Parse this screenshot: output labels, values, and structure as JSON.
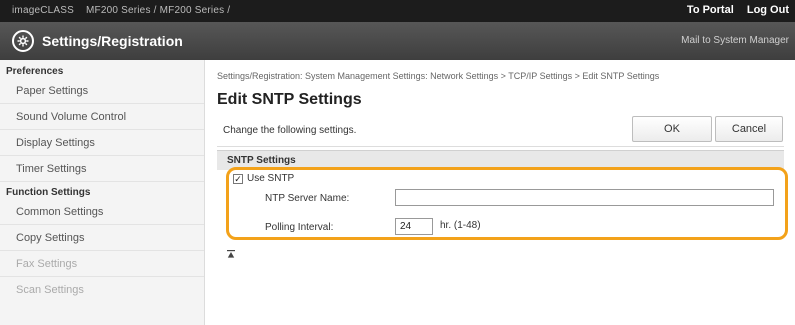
{
  "topbar": {
    "crumb": [
      "imageCLASS",
      "MF200 Series",
      "MF200 Series",
      ""
    ],
    "portal_label": "To Portal",
    "logout_label": "Log Out"
  },
  "header": {
    "title": "Settings/Registration",
    "mailto": "Mail to System Manager"
  },
  "sidebar": {
    "section_preferences": "Preferences",
    "preferences_items": [
      "Paper Settings",
      "Sound Volume Control",
      "Display Settings",
      "Timer Settings"
    ],
    "section_function": "Function Settings",
    "function_items": [
      "Common Settings",
      "Copy Settings",
      "Fax Settings",
      "Scan Settings"
    ]
  },
  "main": {
    "breadcrumb": "Settings/Registration: System Management Settings: Network Settings > TCP/IP Settings > Edit SNTP Settings",
    "title": "Edit SNTP Settings",
    "instruction": "Change the following settings.",
    "ok_label": "OK",
    "cancel_label": "Cancel",
    "section_title": "SNTP Settings",
    "use_sntp_label": "Use SNTP",
    "use_sntp_checked": true,
    "server_name_label": "NTP Server Name:",
    "server_name_value": "",
    "polling_label": "Polling Interval:",
    "polling_value": "24",
    "polling_unit": "hr. (1-48)"
  },
  "colors": {
    "highlight": "#f3a21a",
    "topbar": "#1c1c1c",
    "titlebar": "#4a4a4a"
  }
}
